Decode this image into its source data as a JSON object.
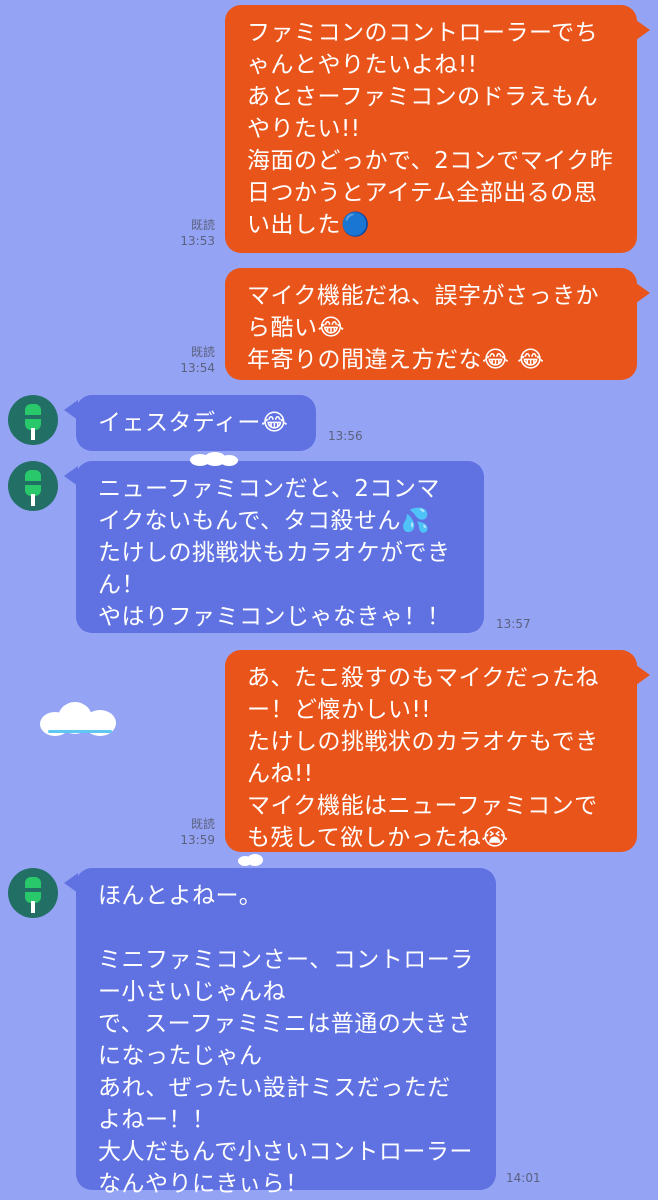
{
  "messages": [
    {
      "from": "me",
      "text": "ファミコンのコントローラーでちゃんとやりたいよね!!\nあとさーファミコンのドラえもんやりたい!!\n海面のどっかで、2コンでマイク昨日つかうとアイテム全部出るの思い出した🔵",
      "read": "既読",
      "time": "13:53"
    },
    {
      "from": "me",
      "text": "マイク機能だね、誤字がさっきから酷い😂\n年寄りの間違え方だな😂 😂",
      "read": "既読",
      "time": "13:54"
    },
    {
      "from": "friend",
      "text": "イェスタディー😂",
      "time": "13:56"
    },
    {
      "from": "friend",
      "text": "ニューファミコンだと、2コンマイクないもんで、タコ殺せん💦\nたけしの挑戦状もカラオケができん！\nやはりファミコンじゃなきゃ！！",
      "time": "13:57"
    },
    {
      "from": "me",
      "text": "あ、たこ殺すのもマイクだったねー！ど懐かしい!!\nたけしの挑戦状のカラオケもできんね!!\nマイク機能はニューファミコンでも残して欲しかったね😭",
      "read": "既読",
      "time": "13:59"
    },
    {
      "from": "friend",
      "text": "ほんとよねー。\n\nミニファミコンさー、コントローラー小さいじゃんね\nで、スーファミミニは普通の大きさになったじゃん\nあれ、ぜったい設計ミスだっただよねー！！\n大人だもんで小さいコントローラーなんやりにきぃら！",
      "time": "14:01"
    }
  ],
  "colors": {
    "background": "#95a3f4",
    "outgoing": "#e9541a",
    "incoming": "#6072e2",
    "avatar": "#226f66"
  },
  "icons": [
    "avatar-icon",
    "cloud-icon"
  ]
}
